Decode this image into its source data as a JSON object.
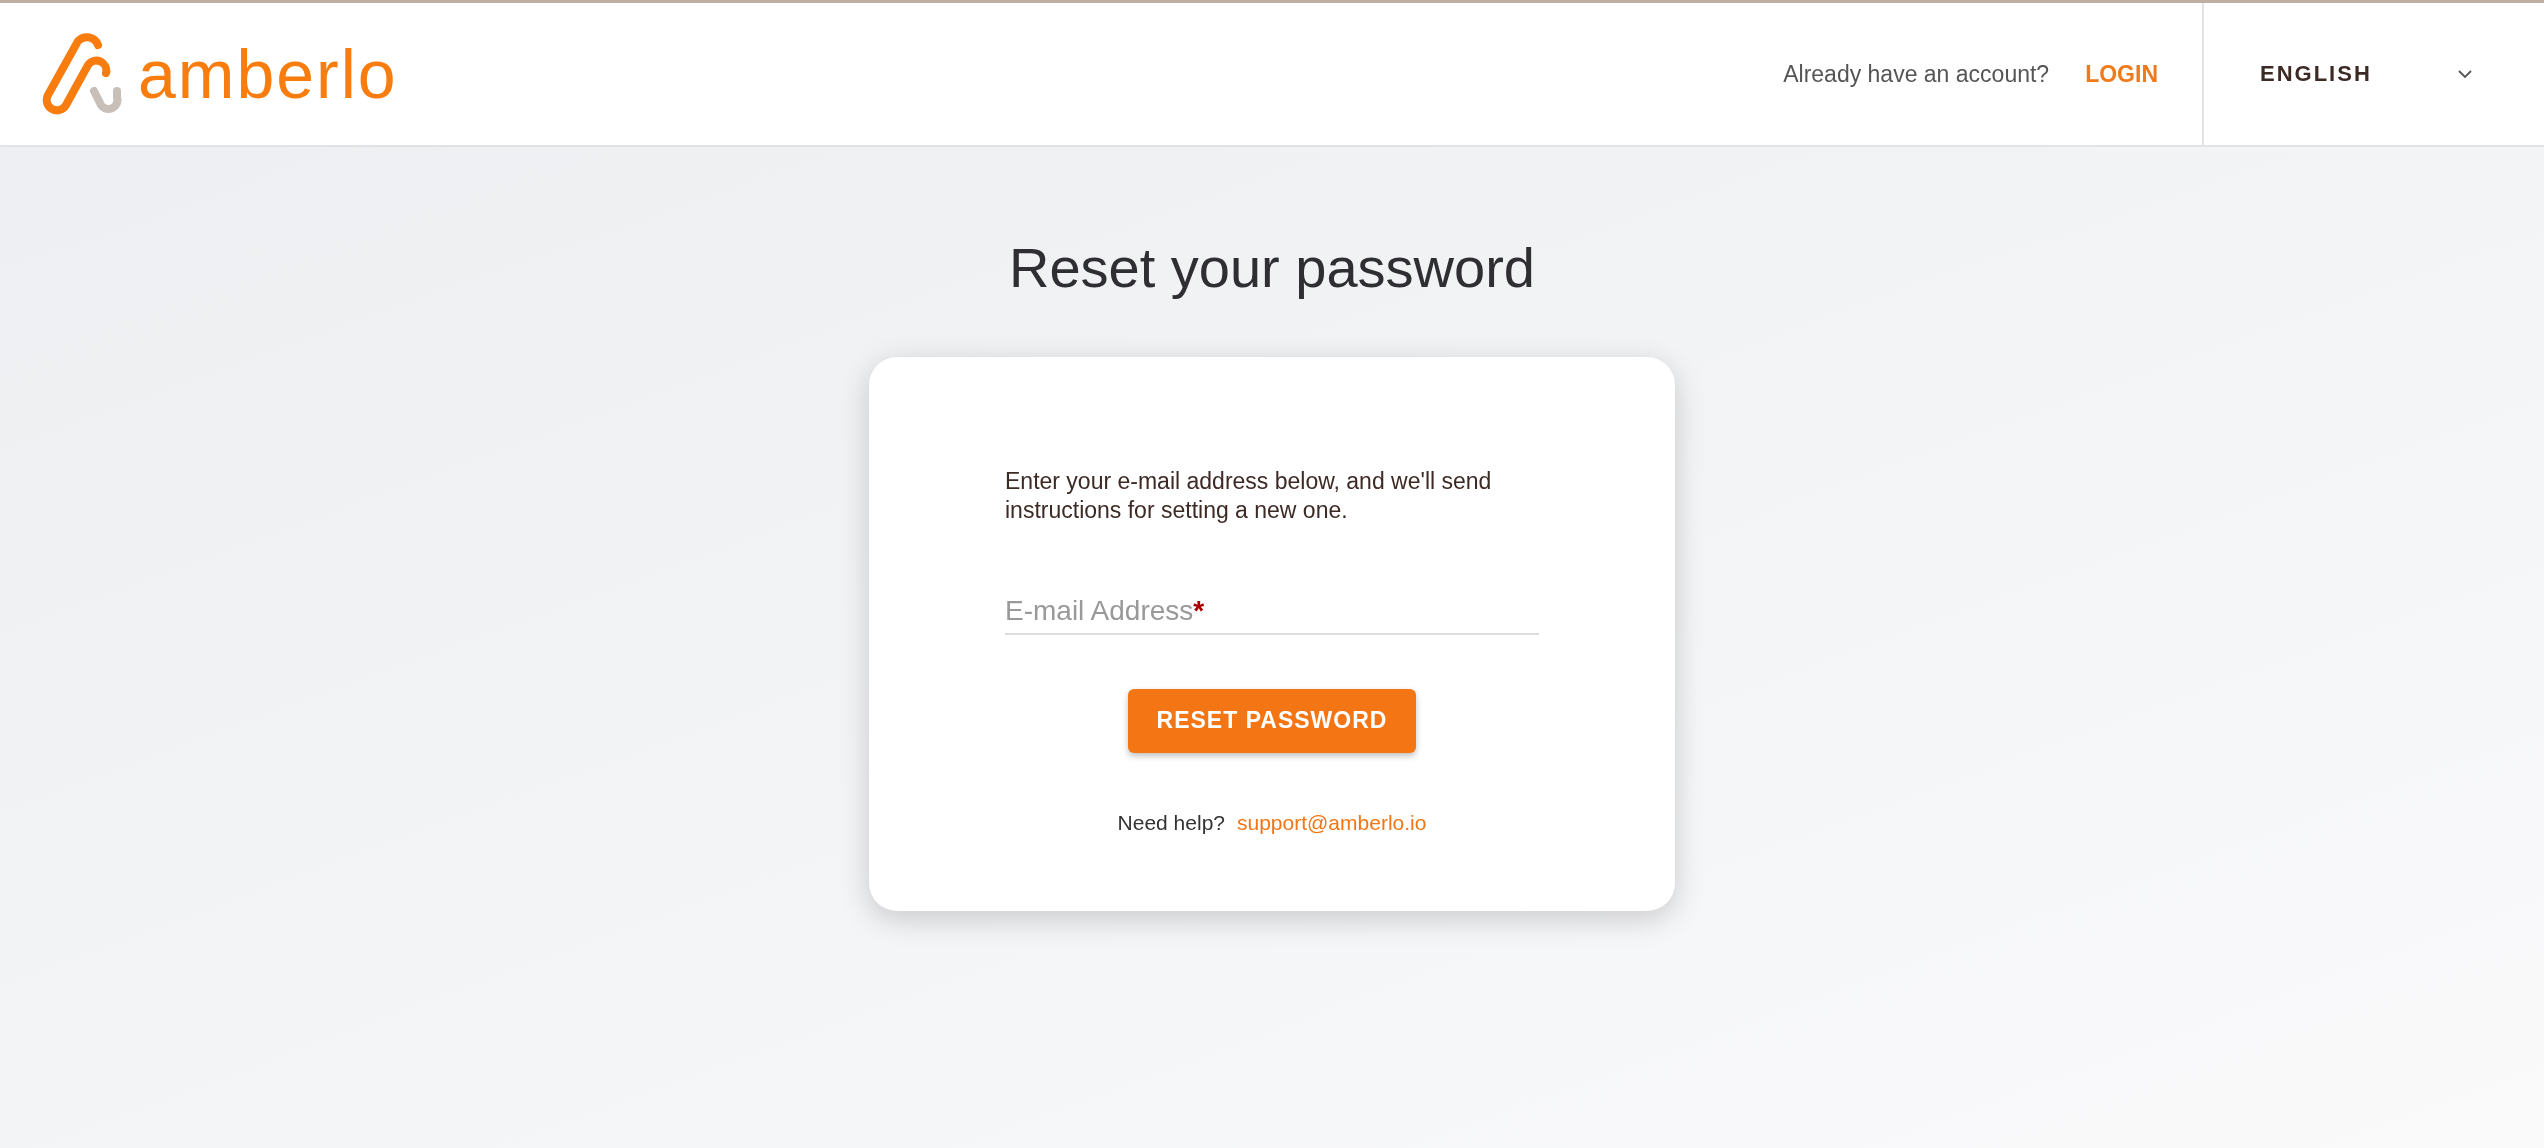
{
  "header": {
    "brand": "amberlo",
    "account_prompt": "Already have an account?",
    "login_link": "LOGIN",
    "language": "ENGLISH"
  },
  "page_title": "Reset your password",
  "card": {
    "instructions": "Enter your e-mail address below, and we'll send instructions for setting a new one.",
    "email_field": {
      "label": "E-mail Address",
      "required_mark": "*"
    },
    "submit_button": "RESET PASSWORD",
    "help_text": "Need help?",
    "help_link": "support@amberlo.io"
  }
}
